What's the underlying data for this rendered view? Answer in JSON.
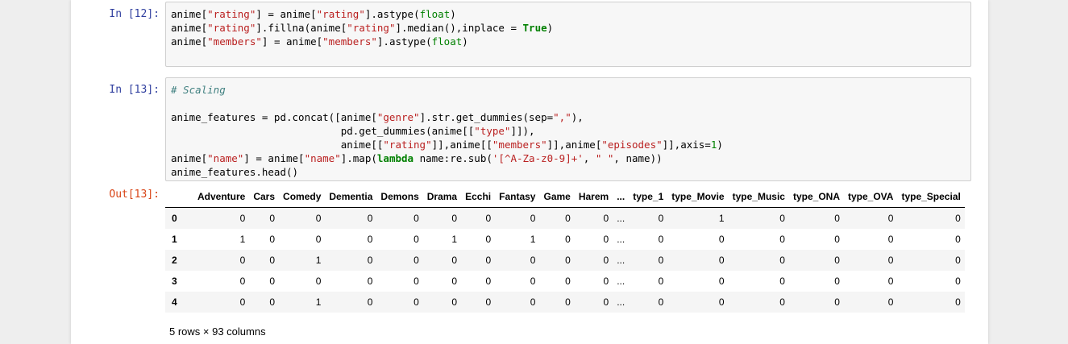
{
  "cells": [
    {
      "prompt": "In [12]:",
      "lines": [
        [
          [
            "t",
            "anime["
          ],
          [
            "s",
            "\"rating\""
          ],
          [
            "t",
            "] = anime["
          ],
          [
            "s",
            "\"rating\""
          ],
          [
            "t",
            "].astype("
          ],
          [
            "n",
            "float"
          ],
          [
            "t",
            ")"
          ]
        ],
        [
          [
            "t",
            "anime["
          ],
          [
            "s",
            "\"rating\""
          ],
          [
            "t",
            "].fillna(anime["
          ],
          [
            "s",
            "\"rating\""
          ],
          [
            "t",
            "].median(),inplace = "
          ],
          [
            "k",
            "True"
          ],
          [
            "t",
            ")"
          ]
        ],
        [
          [
            "t",
            "anime["
          ],
          [
            "s",
            "\"members\""
          ],
          [
            "t",
            "] = anime["
          ],
          [
            "s",
            "\"members\""
          ],
          [
            "t",
            "].astype("
          ],
          [
            "n",
            "float"
          ],
          [
            "t",
            ")"
          ]
        ],
        []
      ]
    },
    {
      "prompt": "In [13]:",
      "lines": [
        [
          [
            "c",
            "# Scaling"
          ]
        ],
        [],
        [
          [
            "t",
            "anime_features = pd.concat([anime["
          ],
          [
            "s",
            "\"genre\""
          ],
          [
            "t",
            "].str.get_dummies(sep="
          ],
          [
            "s",
            "\",\""
          ],
          [
            "t",
            "),"
          ]
        ],
        [
          [
            "t",
            "                            pd.get_dummies(anime[["
          ],
          [
            "s",
            "\"type\""
          ],
          [
            "t",
            "]]),"
          ]
        ],
        [
          [
            "t",
            "                            anime[["
          ],
          [
            "s",
            "\"rating\""
          ],
          [
            "t",
            "]],anime[["
          ],
          [
            "s",
            "\"members\""
          ],
          [
            "t",
            "]],anime["
          ],
          [
            "s",
            "\"episodes\""
          ],
          [
            "t",
            "]],axis="
          ],
          [
            "n",
            "1"
          ],
          [
            "t",
            ")"
          ]
        ],
        [
          [
            "t",
            "anime["
          ],
          [
            "s",
            "\"name\""
          ],
          [
            "t",
            "] = anime["
          ],
          [
            "s",
            "\"name\""
          ],
          [
            "t",
            "].map("
          ],
          [
            "k",
            "lambda"
          ],
          [
            "t",
            " name:re.sub("
          ],
          [
            "s",
            "'[^A-Za-z0-9]+'"
          ],
          [
            "t",
            ", "
          ],
          [
            "s",
            "\" \""
          ],
          [
            "t",
            ", name))"
          ]
        ],
        [
          [
            "t",
            "anime_features.head()"
          ]
        ]
      ]
    }
  ],
  "output_prompt": "Out[13]:",
  "table": {
    "columns": [
      "",
      "Adventure",
      "Cars",
      "Comedy",
      "Dementia",
      "Demons",
      "Drama",
      "Ecchi",
      "Fantasy",
      "Game",
      "Harem",
      "...",
      "type_1",
      "type_Movie",
      "type_Music",
      "type_ONA",
      "type_OVA",
      "type_Special"
    ],
    "rows": [
      [
        "0",
        "0",
        "0",
        "0",
        "0",
        "0",
        "0",
        "0",
        "0",
        "0",
        "0",
        "...",
        "0",
        "1",
        "0",
        "0",
        "0",
        "0"
      ],
      [
        "1",
        "1",
        "0",
        "0",
        "0",
        "0",
        "1",
        "0",
        "1",
        "0",
        "0",
        "...",
        "0",
        "0",
        "0",
        "0",
        "0",
        "0"
      ],
      [
        "2",
        "0",
        "0",
        "1",
        "0",
        "0",
        "0",
        "0",
        "0",
        "0",
        "0",
        "...",
        "0",
        "0",
        "0",
        "0",
        "0",
        "0"
      ],
      [
        "3",
        "0",
        "0",
        "0",
        "0",
        "0",
        "0",
        "0",
        "0",
        "0",
        "0",
        "...",
        "0",
        "0",
        "0",
        "0",
        "0",
        "0"
      ],
      [
        "4",
        "0",
        "0",
        "1",
        "0",
        "0",
        "0",
        "0",
        "0",
        "0",
        "0",
        "...",
        "0",
        "0",
        "0",
        "0",
        "0",
        "0"
      ]
    ]
  },
  "shape_note": "5 rows × 93 columns"
}
